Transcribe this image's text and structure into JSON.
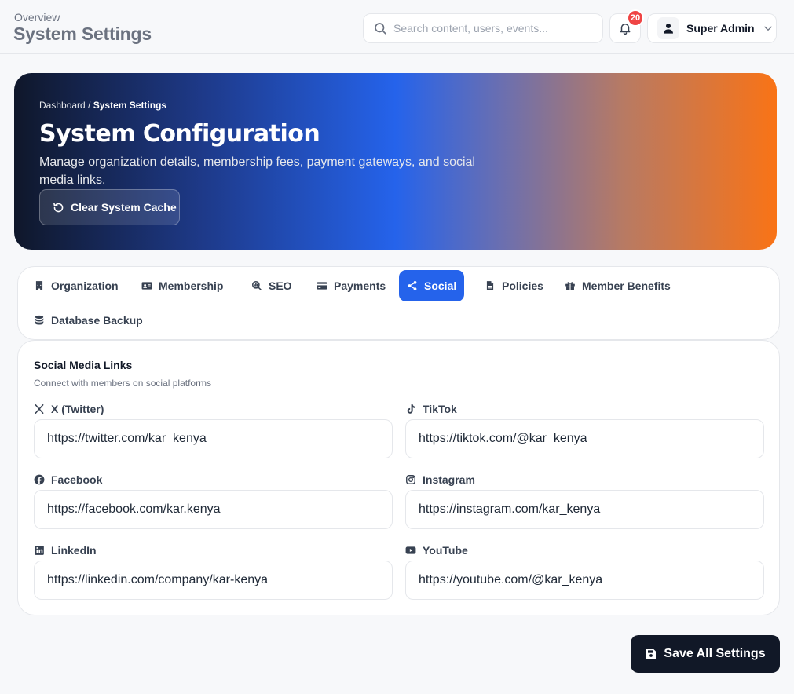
{
  "header": {
    "overview_label": "Overview",
    "title": "System Settings",
    "search_placeholder": "Search content, users, events...",
    "notification_count": "20",
    "user_name": "Super Admin"
  },
  "hero": {
    "breadcrumb_root": "Dashboard",
    "breadcrumb_sep": " / ",
    "breadcrumb_current": "System Settings",
    "title": "System Configuration",
    "description": "Manage organization details, membership fees, payment gateways, and social media links.",
    "cache_button": "Clear System Cache"
  },
  "tabs": [
    {
      "label": "Organization",
      "icon": "building-icon"
    },
    {
      "label": "Membership",
      "icon": "id-card-icon"
    },
    {
      "label": "SEO",
      "icon": "chart-search-icon"
    },
    {
      "label": "Payments",
      "icon": "credit-card-icon"
    },
    {
      "label": "Social",
      "icon": "share-icon",
      "active": true
    },
    {
      "label": "Policies",
      "icon": "file-icon"
    },
    {
      "label": "Member Benefits",
      "icon": "gift-icon"
    },
    {
      "label": "Database Backup",
      "icon": "database-icon"
    }
  ],
  "social": {
    "title": "Social Media Links",
    "subtitle": "Connect with members on social platforms",
    "fields": [
      {
        "label": "X (Twitter)",
        "icon": "x-twitter-icon",
        "value": "https://twitter.com/kar_kenya"
      },
      {
        "label": "TikTok",
        "icon": "tiktok-icon",
        "value": "https://tiktok.com/@kar_kenya"
      },
      {
        "label": "Facebook",
        "icon": "facebook-icon",
        "value": "https://facebook.com/kar.kenya"
      },
      {
        "label": "Instagram",
        "icon": "instagram-icon",
        "value": "https://instagram.com/kar_kenya"
      },
      {
        "label": "LinkedIn",
        "icon": "linkedin-icon",
        "value": "https://linkedin.com/company/kar-kenya"
      },
      {
        "label": "YouTube",
        "icon": "youtube-icon",
        "value": "https://youtube.com/@kar_kenya"
      }
    ]
  },
  "save_button": "Save All Settings",
  "colors": {
    "accent": "#2563eb",
    "dark": "#111827",
    "badge": "#ef4444",
    "hero_orange": "#f97316"
  }
}
